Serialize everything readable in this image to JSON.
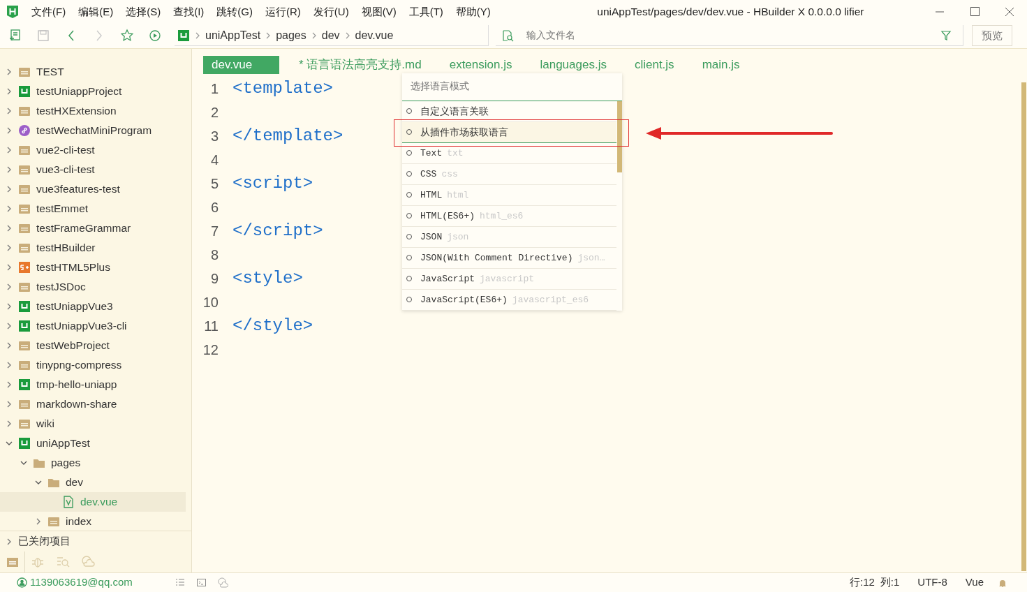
{
  "window": {
    "title": "uniAppTest/pages/dev/dev.vue - HBuilder X 0.0.0.0 lifier"
  },
  "menu": [
    "文件(F)",
    "编辑(E)",
    "选择(S)",
    "查找(I)",
    "跳转(G)",
    "运行(R)",
    "发行(U)",
    "视图(V)",
    "工具(T)",
    "帮助(Y)"
  ],
  "toolbar": {
    "breadcrumb": [
      "uniAppTest",
      "pages",
      "dev",
      "dev.vue"
    ],
    "search": {
      "placeholder": "输入文件名"
    },
    "preview_button": "预览"
  },
  "sidebar": {
    "tree": [
      {
        "label": "TEST",
        "kind": "folder",
        "expanded": false,
        "selected": false
      },
      {
        "label": "testUniappProject",
        "kind": "uniapp",
        "expanded": false,
        "selected": false
      },
      {
        "label": "testHXExtension",
        "kind": "folder",
        "expanded": false,
        "selected": false
      },
      {
        "label": "testWechatMiniProgram",
        "kind": "wechat",
        "expanded": false,
        "selected": false
      },
      {
        "label": "vue2-cli-test",
        "kind": "folder",
        "expanded": false,
        "selected": false
      },
      {
        "label": "vue3-cli-test",
        "kind": "folder",
        "expanded": false,
        "selected": false
      },
      {
        "label": "vue3features-test",
        "kind": "folder",
        "expanded": false,
        "selected": false
      },
      {
        "label": "testEmmet",
        "kind": "folder",
        "expanded": false,
        "selected": false
      },
      {
        "label": "testFrameGrammar",
        "kind": "folder",
        "expanded": false,
        "selected": false
      },
      {
        "label": "testHBuilder",
        "kind": "folder",
        "expanded": false,
        "selected": false
      },
      {
        "label": "testHTML5Plus",
        "kind": "html5plus",
        "expanded": false,
        "selected": false
      },
      {
        "label": "testJSDoc",
        "kind": "folder",
        "expanded": false,
        "selected": false
      },
      {
        "label": "testUniappVue3",
        "kind": "uniapp",
        "expanded": false,
        "selected": false
      },
      {
        "label": "testUniappVue3-cli",
        "kind": "uniapp",
        "expanded": false,
        "selected": false
      },
      {
        "label": "testWebProject",
        "kind": "folder",
        "expanded": false,
        "selected": false
      },
      {
        "label": "tinypng-compress",
        "kind": "folder",
        "expanded": false,
        "selected": false
      },
      {
        "label": "tmp-hello-uniapp",
        "kind": "uniapp",
        "expanded": false,
        "selected": false
      },
      {
        "label": "markdown-share",
        "kind": "folder",
        "expanded": false,
        "selected": false
      },
      {
        "label": "wiki",
        "kind": "folder",
        "expanded": false,
        "selected": false
      },
      {
        "label": "uniAppTest",
        "kind": "uniapp",
        "expanded": true,
        "selected": false,
        "children": [
          {
            "label": "pages",
            "kind": "folder",
            "expanded": true,
            "selected": false,
            "children": [
              {
                "label": "dev",
                "kind": "folder",
                "expanded": true,
                "selected": false,
                "children": [
                  {
                    "label": "dev.vue",
                    "kind": "vue",
                    "selected": true
                  }
                ]
              },
              {
                "label": "index",
                "kind": "folder",
                "expanded": false,
                "selected": false
              }
            ]
          }
        ]
      }
    ],
    "closed_projects": {
      "label": "已关闭项目",
      "expanded": false
    },
    "tabs": [
      {
        "kind": "files",
        "selected": true
      },
      {
        "kind": "debug",
        "selected": false
      },
      {
        "kind": "search",
        "selected": false
      },
      {
        "kind": "cloud",
        "selected": false
      }
    ]
  },
  "editor": {
    "tabs": [
      {
        "label": "dev.vue",
        "selected": true
      },
      {
        "label": "* 语言语法高亮支持.md",
        "selected": false
      },
      {
        "label": "extension.js",
        "selected": false
      },
      {
        "label": "languages.js",
        "selected": false
      },
      {
        "label": "client.js",
        "selected": false
      },
      {
        "label": "main.js",
        "selected": false
      }
    ],
    "lines": [
      {
        "number": "1",
        "code": "<template>"
      },
      {
        "number": "2"
      },
      {
        "number": "3",
        "code": "</template>"
      },
      {
        "number": "4"
      },
      {
        "number": "5",
        "code": "<script>"
      },
      {
        "number": "6"
      },
      {
        "number": "7",
        "code": "</script>"
      },
      {
        "number": "8"
      },
      {
        "number": "9",
        "code": "<style>"
      },
      {
        "number": "10"
      },
      {
        "number": "11",
        "code": "</style>"
      },
      {
        "number": "12"
      }
    ]
  },
  "language_picker": {
    "placeholder": "选择语言模式",
    "items": [
      {
        "label": "自定义语言关联",
        "selected": false
      },
      {
        "label": "从插件市场获取语言",
        "selected": true
      },
      {
        "label": "Text",
        "id": "txt",
        "selected": false
      },
      {
        "label": "CSS",
        "id": "css",
        "selected": false
      },
      {
        "label": "HTML",
        "id": "html",
        "selected": false
      },
      {
        "label": "HTML(ES6+)",
        "id": "html_es6",
        "selected": false
      },
      {
        "label": "JSON",
        "id": "json",
        "selected": false
      },
      {
        "label": "JSON(With Comment Directive)",
        "id": "json…",
        "selected": false
      },
      {
        "label": "JavaScript",
        "id": "javascript",
        "selected": false
      },
      {
        "label": "JavaScript(ES6+)",
        "id": "javascript_es6",
        "selected": false
      }
    ]
  },
  "status_bar": {
    "user": "1139063619@qq.com",
    "line": "行:12",
    "column": "列:1",
    "encoding": "UTF-8",
    "language": "Vue"
  }
}
